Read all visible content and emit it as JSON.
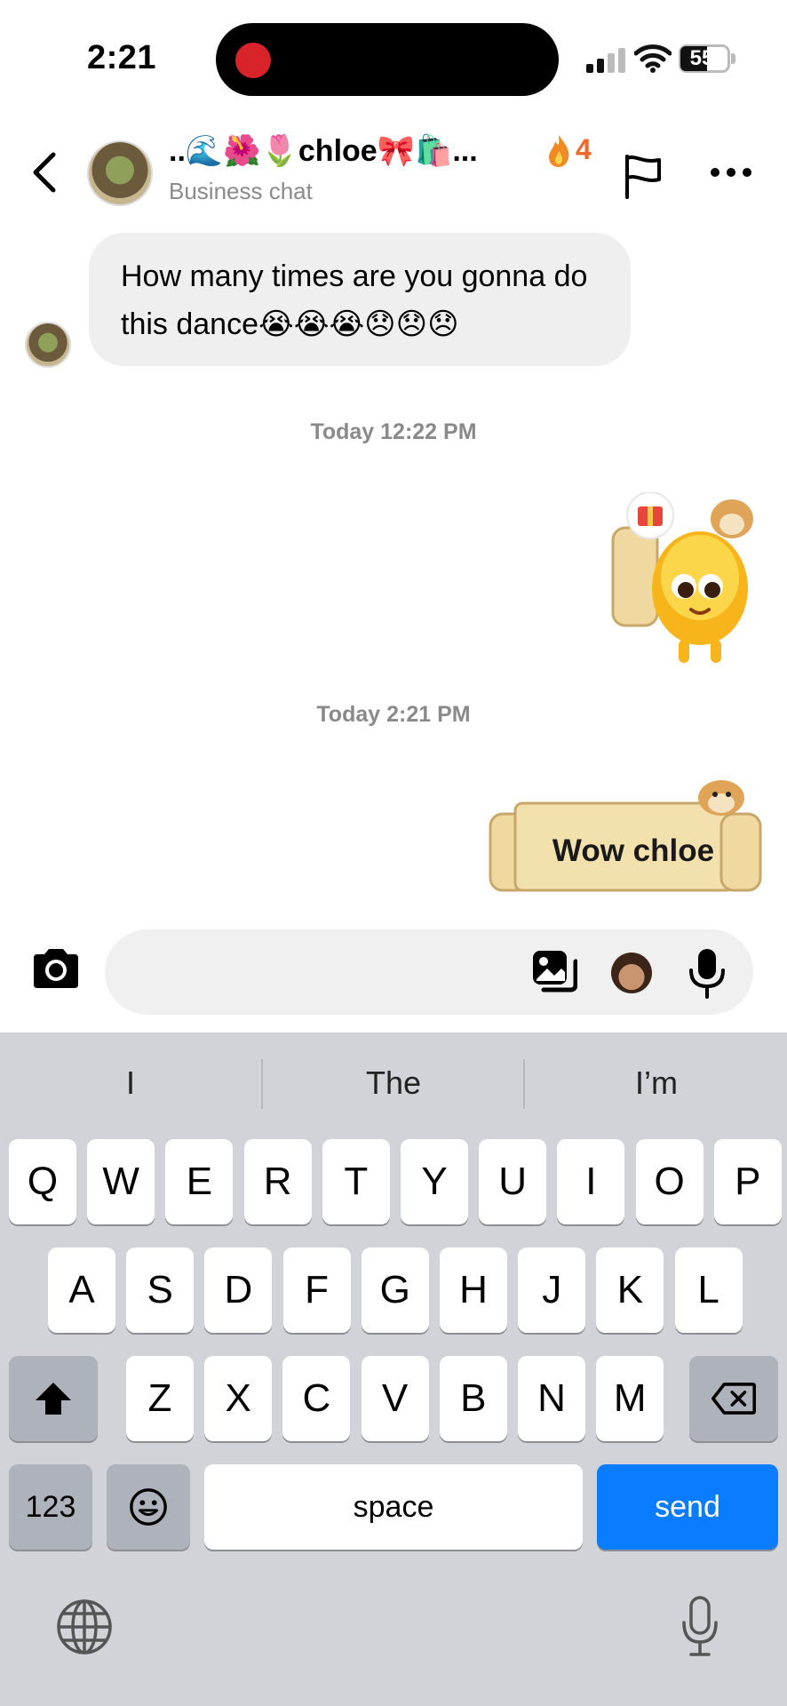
{
  "status_bar": {
    "time": "2:21",
    "battery": "55"
  },
  "header": {
    "name": "..🌊🌺🌷chloe🎀🛍️...",
    "streak": "4",
    "subtitle": "Business chat"
  },
  "messages": {
    "incoming_text": "How many times are you gonna do this dance😭😭😭😞😞😞",
    "timestamp_1": "Today 12:22 PM",
    "timestamp_2": "Today 2:21 PM",
    "sticker_label": "Wow chloe"
  },
  "composer": {
    "placeholder": ""
  },
  "keyboard": {
    "suggestions": [
      "I",
      "The",
      "I’m"
    ],
    "row1": [
      "Q",
      "W",
      "E",
      "R",
      "T",
      "Y",
      "U",
      "I",
      "O",
      "P"
    ],
    "row2": [
      "A",
      "S",
      "D",
      "F",
      "G",
      "H",
      "J",
      "K",
      "L"
    ],
    "row3": [
      "Z",
      "X",
      "C",
      "V",
      "B",
      "N",
      "M"
    ],
    "numbers_label": "123",
    "space_label": "space",
    "send_label": "send"
  },
  "colors": {
    "send_blue": "#0a7cff",
    "streak_orange": "#f0672a",
    "bubble_gray": "#efefef"
  }
}
